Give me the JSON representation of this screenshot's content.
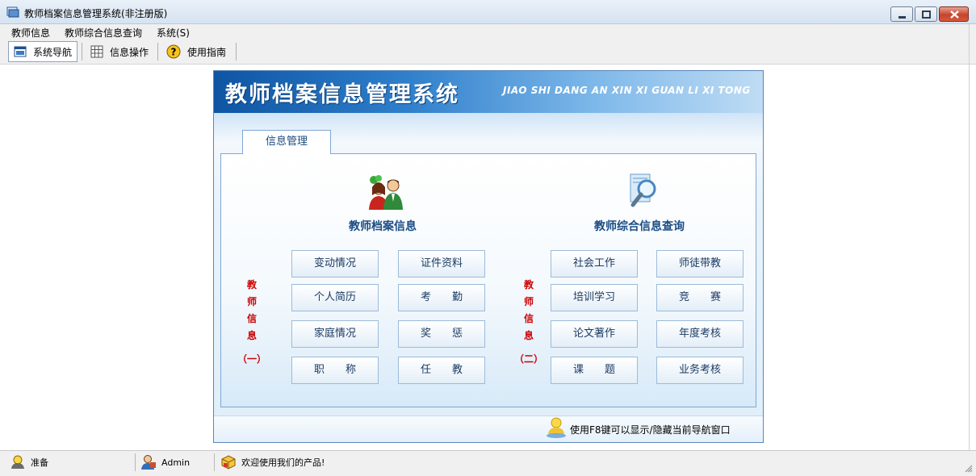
{
  "window": {
    "title": "教师档案信息管理系统(非注册版)"
  },
  "menu": {
    "items": [
      "教师信息",
      "教师综合信息查询",
      "系统(S)"
    ]
  },
  "toolbar": {
    "buttons": [
      {
        "label": "系统导航",
        "icon": "window-icon"
      },
      {
        "label": "信息操作",
        "icon": "grid-icon"
      },
      {
        "label": "使用指南",
        "icon": "help-icon"
      }
    ]
  },
  "banner": {
    "title": "教师档案信息管理系统",
    "pinyin": "JIAO SHI DANG AN XIN XI GUAN LI XI TONG"
  },
  "tab": {
    "label": "信息管理"
  },
  "left_section": {
    "title": "教师档案信息",
    "icon": "teachers-icon",
    "vertical_label": [
      "教",
      "师",
      "信",
      "息"
    ],
    "sub_label": "（一）",
    "buttons": [
      "变动情况",
      "证件资料",
      "个人简历",
      "考　　勤",
      "家庭情况",
      "奖　　惩",
      "职　　称",
      "任　　教"
    ]
  },
  "right_section": {
    "title": "教师综合信息查询",
    "icon": "search-icon",
    "vertical_label": [
      "教",
      "师",
      "信",
      "息"
    ],
    "sub_label": "（二）",
    "buttons": [
      "社会工作",
      "师徒带教",
      "培训学习",
      "竞　　赛",
      "论文著作",
      "年度考核",
      "课　　题",
      "业务考核"
    ]
  },
  "footer": {
    "hint": "使用F8键可以显示/隐藏当前导航窗口"
  },
  "status": {
    "state": "准备",
    "user": "Admin",
    "message": "欢迎使用我们的产品!"
  },
  "colors": {
    "banner_blue": "#0e55a3",
    "title_blue": "#1a4c84",
    "label_red": "#cc0000"
  }
}
